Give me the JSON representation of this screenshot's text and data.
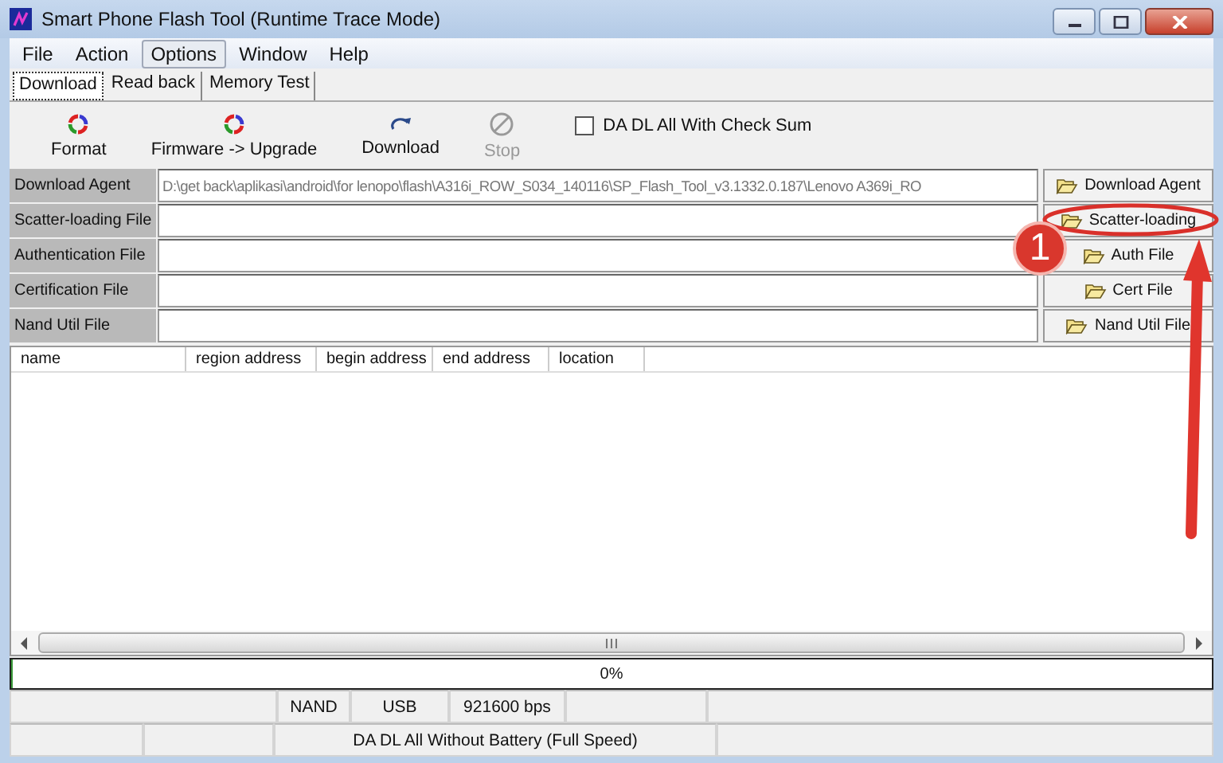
{
  "window": {
    "title": "Smart Phone Flash Tool (Runtime Trace Mode)"
  },
  "menu": [
    {
      "label": "File",
      "selected": false
    },
    {
      "label": "Action",
      "selected": false
    },
    {
      "label": "Options",
      "selected": true
    },
    {
      "label": "Window",
      "selected": false
    },
    {
      "label": "Help",
      "selected": false
    }
  ],
  "tabs": [
    {
      "label": "Download",
      "selected": true
    },
    {
      "label": "Read back",
      "selected": false
    },
    {
      "label": "Memory Test",
      "selected": false
    }
  ],
  "toolbar": [
    {
      "label": "Format",
      "kind": "cycle",
      "disabled": false
    },
    {
      "label": "Firmware -> Upgrade",
      "kind": "cycle",
      "disabled": false
    },
    {
      "label": "Download",
      "kind": "redo",
      "disabled": false
    },
    {
      "label": "Stop",
      "kind": "stop",
      "disabled": true
    }
  ],
  "checksum": {
    "label": "DA DL All With Check Sum",
    "checked": false
  },
  "files": [
    {
      "label": "Download Agent",
      "value": "D:\\get back\\aplikasi\\android\\for lenopo\\flash\\A316i_ROW_S034_140116\\SP_Flash_Tool_v3.1332.0.187\\Lenovo A369i_RO",
      "button": "Download Agent"
    },
    {
      "label": "Scatter-loading File",
      "button": "Scatter-loading"
    },
    {
      "label": "Authentication File",
      "button": "Auth File"
    },
    {
      "label": "Certification File",
      "button": "Cert File"
    },
    {
      "label": "Nand Util File",
      "button": "Nand Util File"
    }
  ],
  "table": {
    "columns": [
      "name",
      "region address",
      "begin address",
      "end address",
      "location"
    ]
  },
  "progress": {
    "label": "0%",
    "level": 0
  },
  "status_bar": {
    "storage": "NAND",
    "port": "USB",
    "baud": "921600 bps",
    "mode": "DA DL All Without Battery (Full Speed)"
  },
  "annotation": {
    "step": "1"
  }
}
